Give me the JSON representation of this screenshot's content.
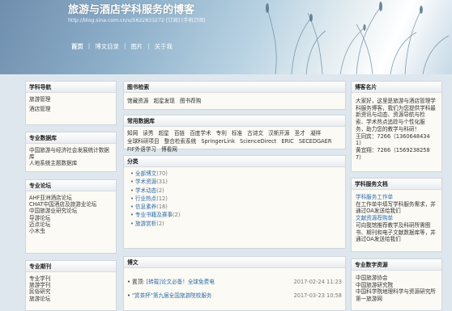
{
  "header": {
    "title": "旅游与酒店学科服务的博客",
    "url": "http://blog.sina.com.cn/u/5622833272",
    "subscribe": "[订阅]",
    "mobile_subscribe": "[手机订阅]"
  },
  "nav": {
    "items": [
      "首页",
      "博文目录",
      "图片",
      "关于我"
    ]
  },
  "left": {
    "subject_nav": {
      "title": "学科导航",
      "items": [
        "旅游管理",
        "酒店管理"
      ]
    },
    "databases": {
      "title": "专业数据库",
      "items": [
        "中国旅游与经济社会发展统计数据",
        "库",
        "人地系统主题数据库"
      ]
    },
    "forums": {
      "title": "专业论坛",
      "items": [
        "AHF亚洲酒店论坛",
        "CHAT中国酒店及旅游业论坛",
        "中国旅游业研究论坛",
        "导游论坛",
        "迈点论坛",
        "小木虫"
      ]
    },
    "journals": {
      "title": "专业期刊",
      "items": [
        "专业学刊",
        "旅游学刊",
        "民俗研究",
        "旅游论坛"
      ]
    }
  },
  "center": {
    "book_search": {
      "title": "图书检索",
      "links": [
        "馆藏资源",
        "超星发现",
        "图书荐购"
      ]
    },
    "common_db": {
      "title": "常用数据库",
      "links": [
        "知网",
        "读秀",
        "超星",
        "百链",
        "百度学术",
        "专利",
        "标准",
        "古诗文",
        "汉斯开源",
        "圣才",
        "凝祥",
        "全球科研项目",
        "整合检索系统",
        "SpringerLink",
        "ScienceDirect",
        "ERIC",
        "SECEDGAER",
        "FIF外语学习",
        "博看网"
      ]
    },
    "categories": {
      "title": "分类",
      "items": [
        {
          "label": "全部博文",
          "count": "(70)"
        },
        {
          "label": "学术资源",
          "count": "(31)"
        },
        {
          "label": "学术动态",
          "count": "(2)"
        },
        {
          "label": "行业热点",
          "count": "(12)"
        },
        {
          "label": "信息素养",
          "count": "(18)"
        },
        {
          "label": "专业书籍及赛事",
          "count": "(2)"
        },
        {
          "label": "旅游赏析",
          "count": "(2)"
        }
      ]
    },
    "posts": {
      "title": "博文",
      "items": [
        {
          "prefix": "置顶: ",
          "title": "[转载]论文必备！全球免费电",
          "date": "2017-02-24 11:23"
        },
        {
          "prefix": "",
          "title": "\"赏茶杯\"第九届全国旅游院校服务",
          "date": "2017-03-23 10:58"
        }
      ]
    }
  },
  "right": {
    "card": {
      "title": "博客名片",
      "lines": [
        "大家好，这里是旅游与酒店管理学",
        "科服务博客，我们为您提供学科最",
        "新资讯与动态、资源导航与检",
        "索、学术热点追踪与个性化服",
        "务，助力您的教学与科研！",
        "王同宾：7266（1360648434",
        "1）",
        "黄宜翔：7266（1569238258",
        "7）"
      ]
    },
    "services": {
      "title": "学科服务文档",
      "lines": [
        {
          "text": "学科服务工作单",
          "blue": true
        },
        {
          "text": "在工作单中填写学科服务需求，并",
          "blue": false
        },
        {
          "text": "通过OA发送给我们",
          "blue": false
        },
        {
          "text": "文献资源荐购单",
          "blue": true
        },
        {
          "text": "可向我馆推荐教学及科研所需图",
          "blue": false
        },
        {
          "text": "书、期刊和电子文献数据库等，并",
          "blue": false
        },
        {
          "text": "通过OA发送给我们",
          "blue": false
        }
      ]
    },
    "institutions": {
      "title": "专业数字资源",
      "items": [
        "中国旅游协会",
        "中国旅游研究院",
        "中国科学院地理科学与资源研究所",
        "第一旅游网"
      ]
    }
  }
}
